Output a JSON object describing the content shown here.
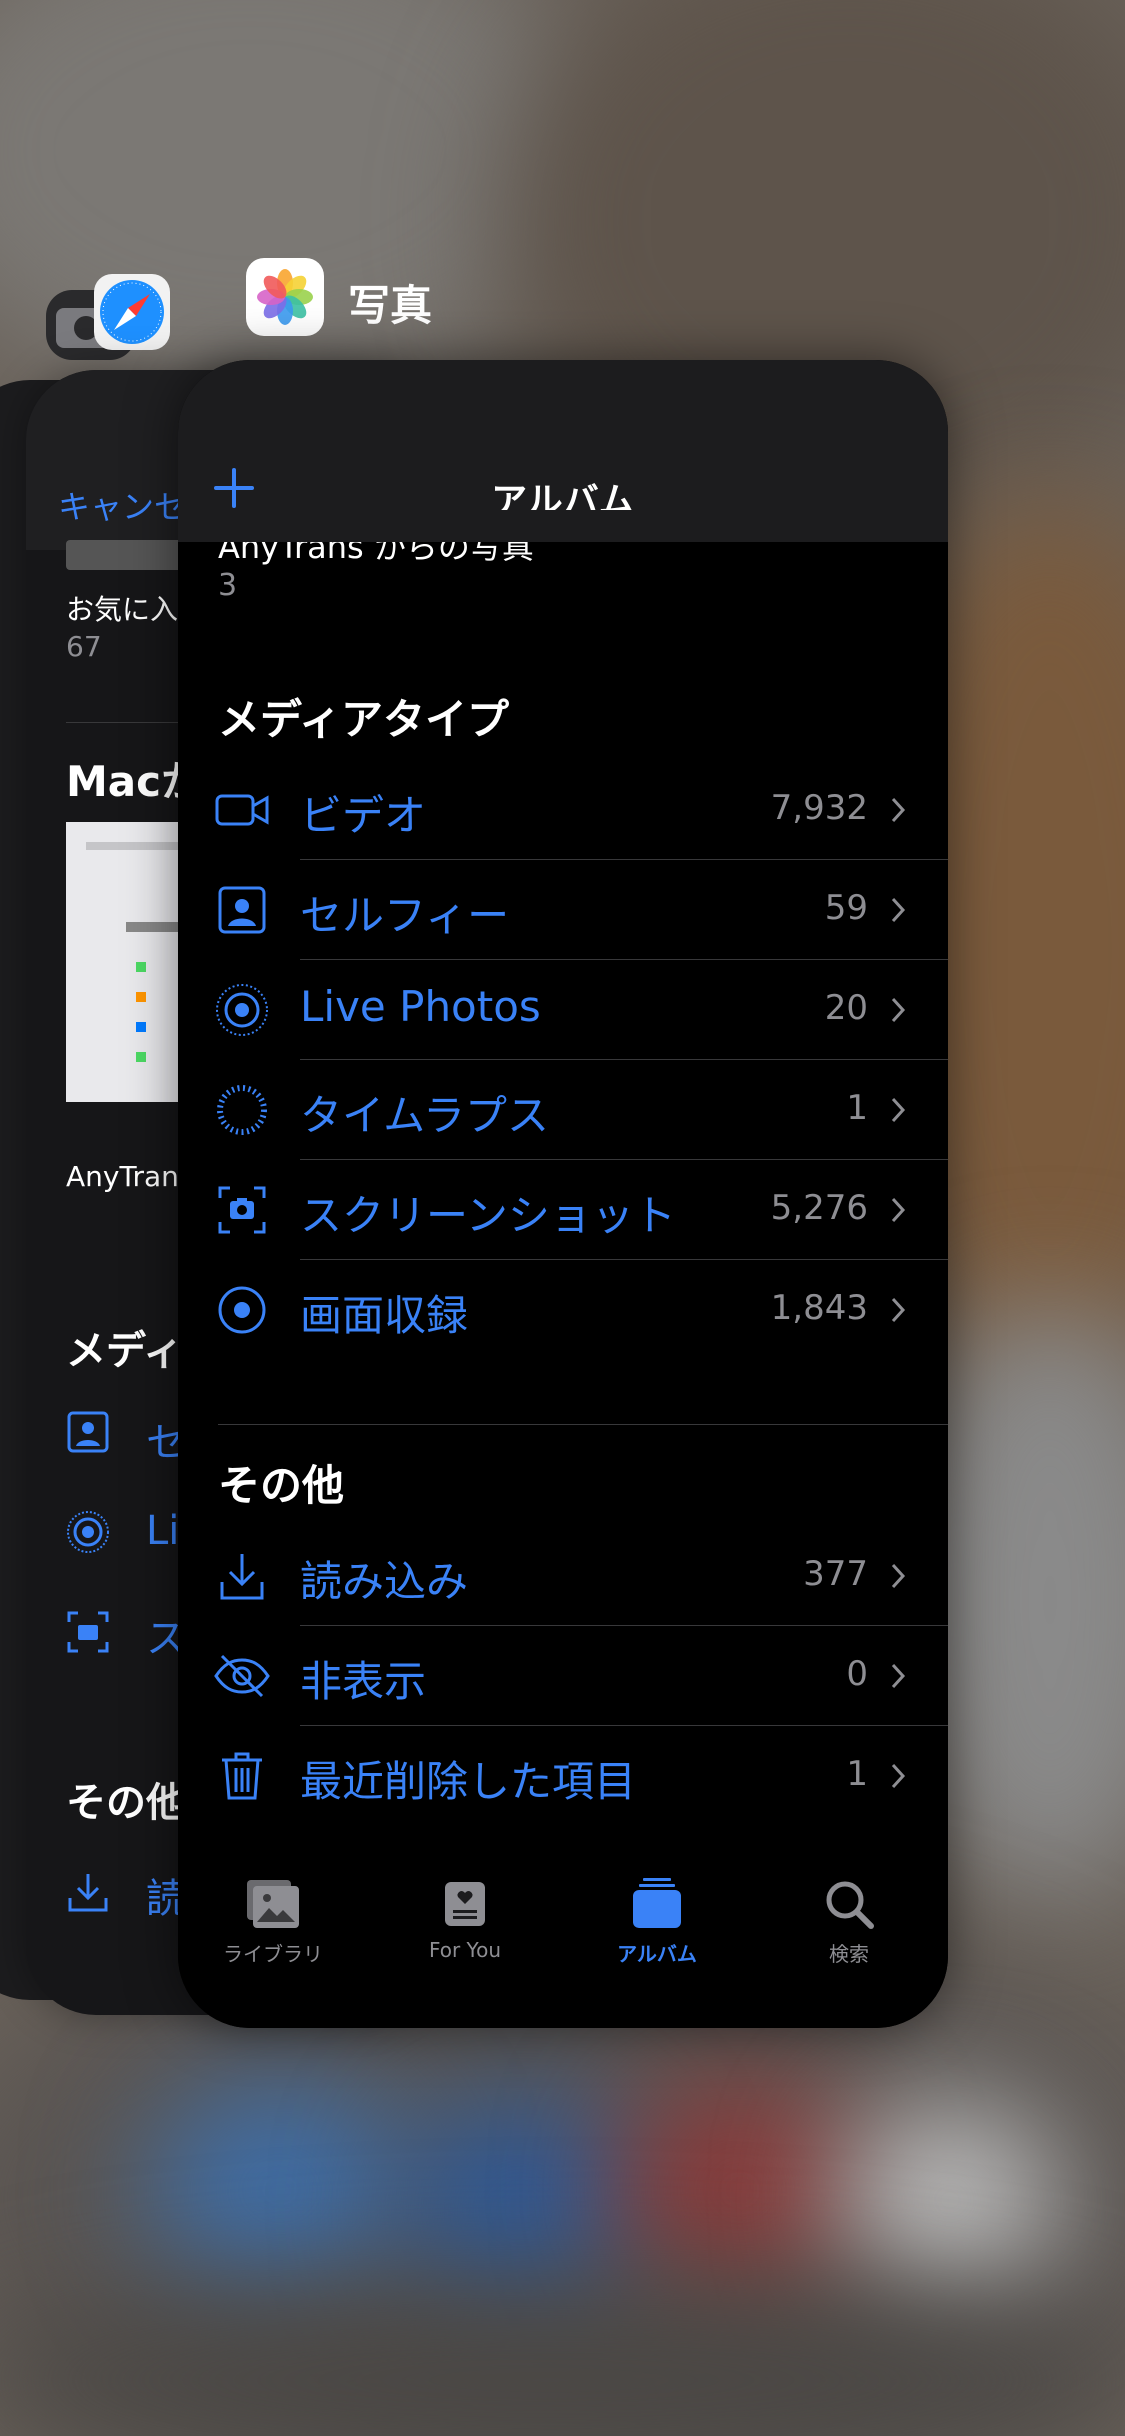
{
  "switcher": {
    "photos_app_title": "写真"
  },
  "background_card": {
    "cancel_label": "キャンセ",
    "favorites_label": "お気に入",
    "favorites_count": "67",
    "mac_heading": "Macか",
    "anytrans_label": "AnyTran",
    "media_heading": "メディ",
    "row1": "セ",
    "row2": "Li",
    "row3": "ス",
    "other_heading": "その他",
    "row4": "読"
  },
  "photos": {
    "nav_title": "アルバム",
    "prev_album_title": "AnyTrans からの写真",
    "prev_album_count": "3",
    "media_types_heading": "メディアタイプ",
    "media_types": [
      {
        "label": "ビデオ",
        "count": "7,932",
        "icon": "video-icon"
      },
      {
        "label": "セルフィー",
        "count": "59",
        "icon": "selfie-icon"
      },
      {
        "label": "Live Photos",
        "count": "20",
        "icon": "live-photo-icon"
      },
      {
        "label": "タイムラプス",
        "count": "1",
        "icon": "timelapse-icon"
      },
      {
        "label": "スクリーンショット",
        "count": "5,276",
        "icon": "screenshot-icon"
      },
      {
        "label": "画面収録",
        "count": "1,843",
        "icon": "screen-record-icon"
      }
    ],
    "other_heading": "その他",
    "other": [
      {
        "label": "読み込み",
        "count": "377",
        "icon": "import-icon"
      },
      {
        "label": "非表示",
        "count": "0",
        "icon": "hidden-icon"
      },
      {
        "label": "最近削除した項目",
        "count": "1",
        "icon": "trash-icon"
      }
    ],
    "tabs": [
      {
        "label": "ライブラリ",
        "icon": "library-icon",
        "active": false
      },
      {
        "label": "For You",
        "icon": "for-you-icon",
        "active": false
      },
      {
        "label": "アルバム",
        "icon": "albums-icon",
        "active": true
      },
      {
        "label": "検索",
        "icon": "search-icon",
        "active": false
      }
    ],
    "accent_color": "#3a82f7"
  }
}
